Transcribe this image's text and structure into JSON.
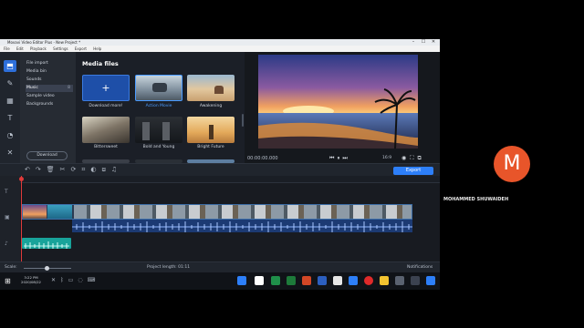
{
  "window": {
    "title": "Movavi Video Editor Plus - New Project *",
    "controls": [
      "–",
      "☐",
      "✕"
    ]
  },
  "menu": [
    "File",
    "Edit",
    "Playback",
    "Settings",
    "Export",
    "Help"
  ],
  "categories": [
    {
      "label": "File import"
    },
    {
      "label": "Media bin"
    },
    {
      "label": "Sounds"
    },
    {
      "label": "Music",
      "count": "8"
    },
    {
      "label": "Sample video"
    },
    {
      "label": "Backgrounds"
    }
  ],
  "download_label": "Download",
  "media": {
    "title": "Media files",
    "items": [
      "Download more!",
      "Action Movie",
      "Awakening",
      "Bittersweet",
      "Bold and Young",
      "Bright Future"
    ]
  },
  "preview": {
    "timecode": "00:00:00.000",
    "aspect": "16:9"
  },
  "export_label": "Export",
  "scale_label": "Scale:",
  "project_length": "Project length: 01:11",
  "notifications": "Notifications",
  "taskbar": {
    "time": "3:22 PM",
    "date": "2020/08/22"
  },
  "participant": {
    "initial": "M",
    "name": "MOHAMMED SHUWAIDEH"
  },
  "colors": {
    "accent": "#2d7ff9",
    "avatar": "#e8552a"
  }
}
